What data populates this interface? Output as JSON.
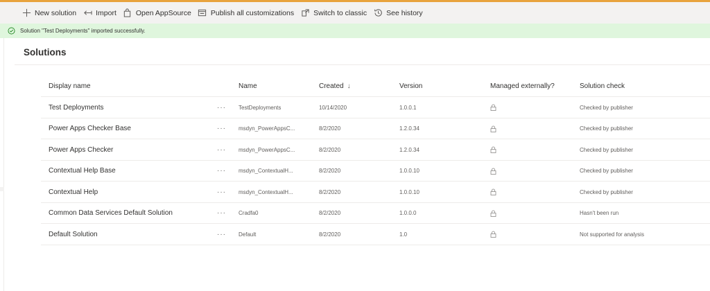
{
  "toolbar": {
    "items": [
      {
        "label": "New solution",
        "icon": "plus-icon"
      },
      {
        "label": "Import",
        "icon": "import-arrow-icon"
      },
      {
        "label": "Open AppSource",
        "icon": "shopping-bag-icon"
      },
      {
        "label": "Publish all customizations",
        "icon": "publish-icon"
      },
      {
        "label": "Switch to classic",
        "icon": "external-switch-icon"
      },
      {
        "label": "See history",
        "icon": "history-icon"
      }
    ]
  },
  "banner": {
    "message": "Solution \"Test Deployments\" imported successfully.",
    "icon": "check-circle-icon",
    "color": "#dff6dd"
  },
  "page": {
    "title": "Solutions"
  },
  "table": {
    "columns": {
      "display_name": "Display name",
      "name": "Name",
      "created": "Created",
      "created_sort": "↓",
      "version": "Version",
      "managed": "Managed externally?",
      "check": "Solution check"
    },
    "more_glyph": "···",
    "rows": [
      {
        "display_name": "Test Deployments",
        "name": "TestDeployments",
        "created": "10/14/2020",
        "version": "1.0.0.1",
        "check": "Checked by publisher"
      },
      {
        "display_name": "Power Apps Checker Base",
        "name": "msdyn_PowerAppsC...",
        "created": "8/2/2020",
        "version": "1.2.0.34",
        "check": "Checked by publisher"
      },
      {
        "display_name": "Power Apps Checker",
        "name": "msdyn_PowerAppsC...",
        "created": "8/2/2020",
        "version": "1.2.0.34",
        "check": "Checked by publisher"
      },
      {
        "display_name": "Contextual Help Base",
        "name": "msdyn_ContextualH...",
        "created": "8/2/2020",
        "version": "1.0.0.10",
        "check": "Checked by publisher"
      },
      {
        "display_name": "Contextual Help",
        "name": "msdyn_ContextualH...",
        "created": "8/2/2020",
        "version": "1.0.0.10",
        "check": "Checked by publisher"
      },
      {
        "display_name": "Common Data Services Default Solution",
        "name": "Cradfa0",
        "created": "8/2/2020",
        "version": "1.0.0.0",
        "check": "Hasn't been run"
      },
      {
        "display_name": "Default Solution",
        "name": "Default",
        "created": "8/2/2020",
        "version": "1.0",
        "check": "Not supported for analysis"
      }
    ]
  },
  "colors": {
    "accent_top": "#e8a33d",
    "command_bar": "#f3f2f1",
    "success_banner": "#dff6dd",
    "success_icon": "#107c10"
  }
}
